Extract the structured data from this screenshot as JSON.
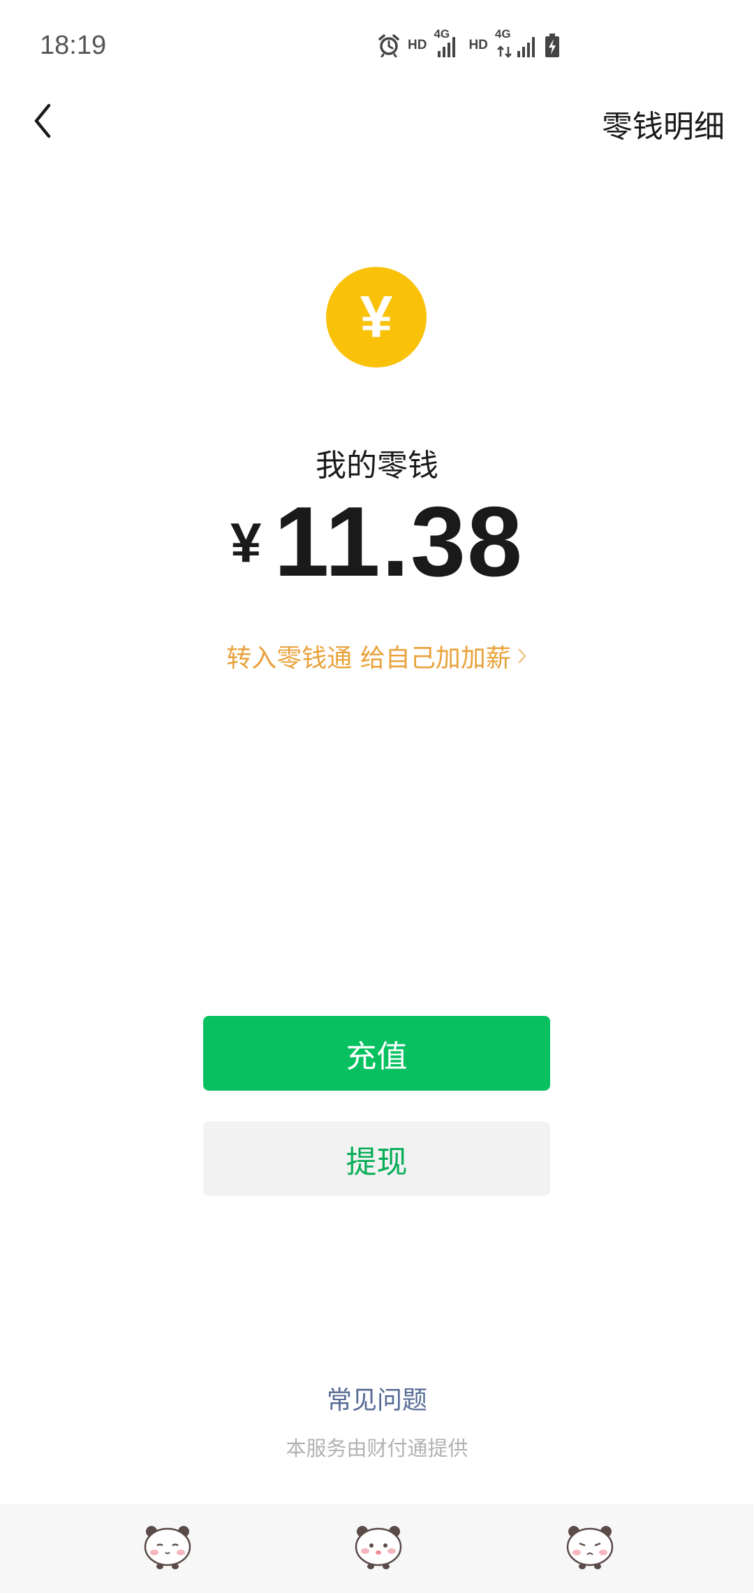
{
  "status_bar": {
    "time": "18:19",
    "hd_label_1": "HD",
    "net_label_1": "4G",
    "hd_label_2": "HD",
    "net_label_2": "4G"
  },
  "nav": {
    "details_label": "零钱明细"
  },
  "wallet": {
    "coin_symbol": "¥",
    "balance_label": "我的零钱",
    "currency_symbol": "¥",
    "balance_amount": "11.38",
    "promo_text": "转入零钱通 给自己加加薪"
  },
  "actions": {
    "topup_label": "充值",
    "withdraw_label": "提现"
  },
  "footer": {
    "faq_label": "常见问题",
    "provider_text": "本服务由财付通提供"
  },
  "colors": {
    "coin": "#fac109",
    "primary_green": "#07c160",
    "withdraw_text": "#06ad56",
    "promo": "#e9a23b",
    "link_blue": "#576b95"
  },
  "icons": {
    "back": "chevron-left-icon",
    "alarm": "alarm-icon",
    "signal": "signal-bars-icon",
    "battery": "battery-charging-icon",
    "promo_chevron": "chevron-right-icon",
    "stickers": [
      "panda-sticker-sleepy",
      "panda-sticker-happy",
      "panda-sticker-sad"
    ]
  }
}
